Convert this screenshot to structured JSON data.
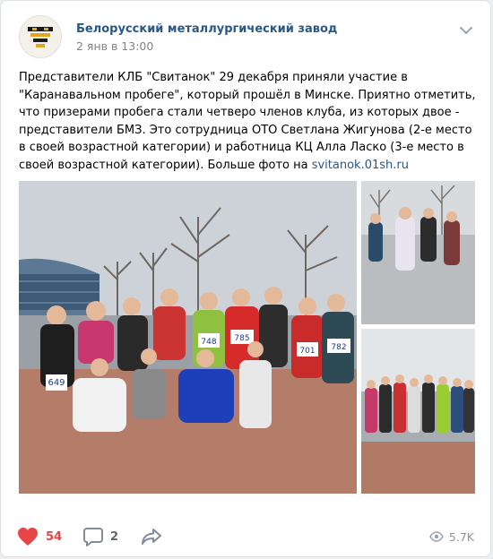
{
  "post": {
    "author": "Белорусский металлургический завод",
    "date": "2 янв в 13:00",
    "text_before_link": "Представители КЛБ \"Свитанок\" 29 декабря приняли участие в \"Каранавальном пробеге\", который прошёл в Минске. Приятно отметить, что призерами пробега стали четверо членов клуба, из которых двое - представители БМЗ. Это сотрудница ОТО Светлана Жигунова (2-е место в своей возрастной категории) и работница КЦ Алла Ласко (3-е место в своей возрастной категории). Больше фото на ",
    "link_text": "svitanok.01sh.ru"
  },
  "photos": {
    "main": {
      "bibs": [
        "649",
        "748",
        "785",
        "701",
        "782"
      ]
    }
  },
  "actions": {
    "likes": "54",
    "comments": "2",
    "views": "5.7K"
  },
  "icons": {
    "like": "heart-icon",
    "comment": "comment-icon",
    "share": "share-arrow-icon",
    "views": "eye-icon",
    "menu": "chevron-down-icon"
  },
  "colors": {
    "author_link": "#2a5885",
    "like_red": "#e64646",
    "muted_gray": "#828282"
  }
}
